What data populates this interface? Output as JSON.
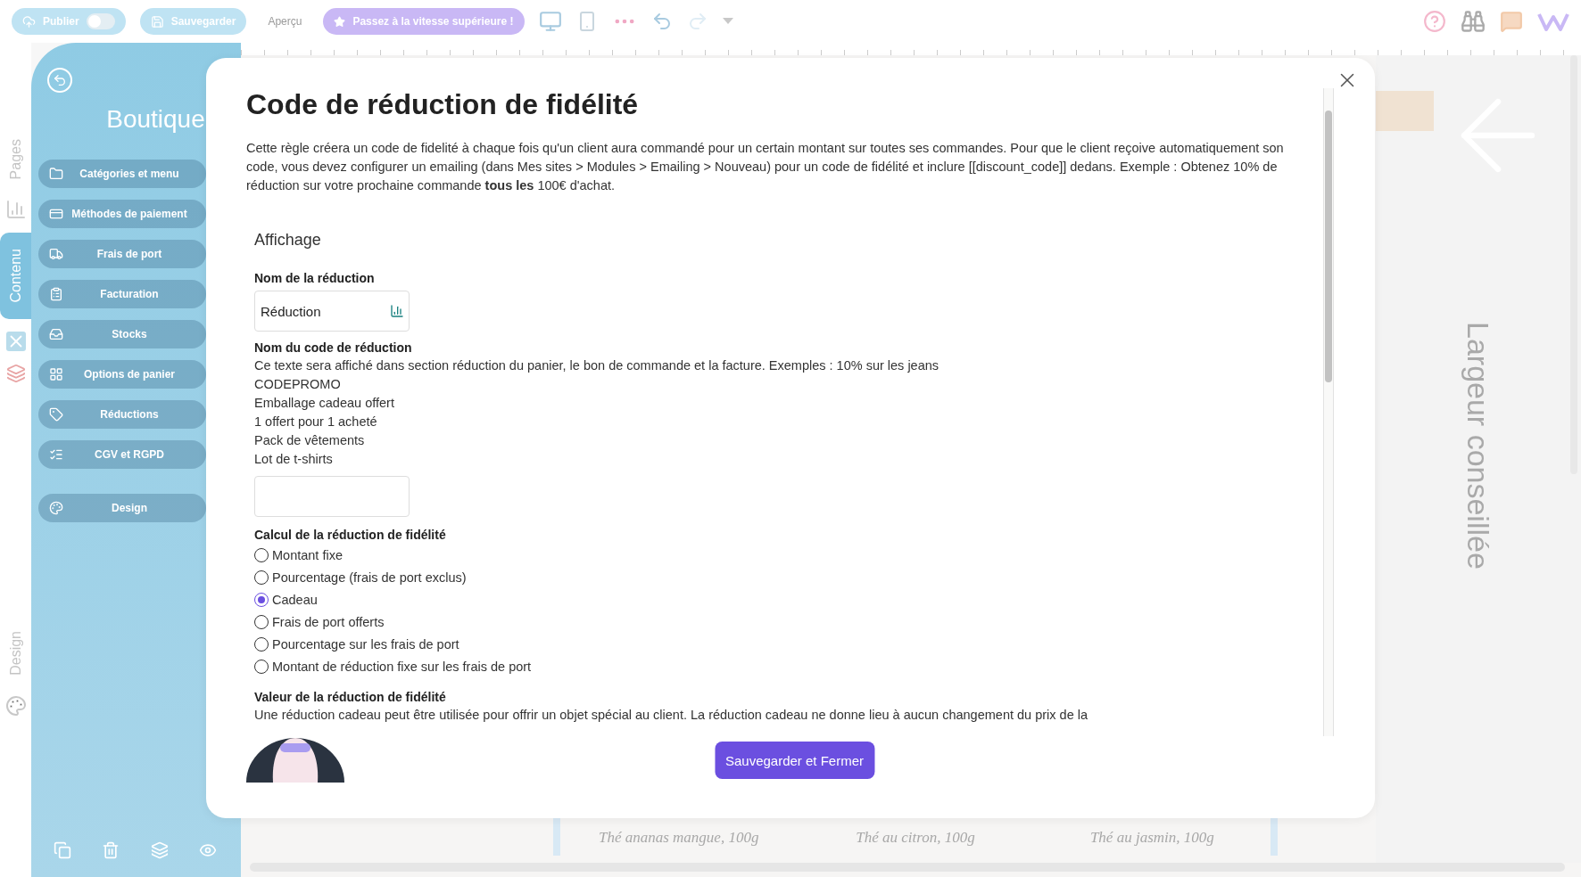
{
  "toolbar": {
    "publish": {
      "label": "Publier",
      "on": false
    },
    "save": "Sauvegarder",
    "preview": "Aperçu",
    "upgrade": "Passez à la vitesse supérieure !"
  },
  "side_tabs": [
    {
      "label": "Pages",
      "selected": false
    },
    {
      "label": "Contenu",
      "selected": true
    },
    {
      "label": "Design",
      "selected": false
    }
  ],
  "sidebar": {
    "title": "Boutique",
    "items": [
      {
        "label": "Catégories et menu"
      },
      {
        "label": "Méthodes de paiement"
      },
      {
        "label": "Frais de port"
      },
      {
        "label": "Facturation"
      },
      {
        "label": "Stocks"
      },
      {
        "label": "Options de panier"
      },
      {
        "label": "Réductions"
      },
      {
        "label": "CGV et RGPD"
      },
      {
        "label": "Design"
      }
    ]
  },
  "canvas": {
    "side_label": "Largeur conseillée",
    "products": [
      "Thé ananas mangue, 100g",
      "Thé au citron, 100g",
      "Thé au jasmin, 100g"
    ]
  },
  "modal": {
    "title": "Code de réduction de fidélité",
    "intro": "Cette règle créera un code de fidelité à chaque fois qu'un client aura commandé pour un certain montant sur toutes ses commandes. Pour que le client reçoive automatiquement son code, vous devez configurer un emailing (dans Mes sites > Modules > Emailing > Nouveau) pour un code de fidélité et inclure [[discount_code]] dedans. Exemple : Obtenez 10% de réduction sur votre prochaine commande **tous les** 100€ d'achat.",
    "section": "Affichage",
    "name_field": {
      "label": "Nom de la réduction",
      "value": "Réduction"
    },
    "code_field": {
      "label": "Nom du code de réduction",
      "help_lines": [
        "Ce texte sera affiché dans section réduction du panier, le bon de commande et la facture. Exemples : 10% sur les jeans",
        "CODEPROMO",
        "Emballage cadeau offert",
        "1 offert pour 1 acheté",
        "Pack de vêtements",
        "Lot de t-shirts"
      ]
    },
    "calc": {
      "label": "Calcul de la réduction de fidélité",
      "options": [
        {
          "label": "Montant fixe",
          "selected": false
        },
        {
          "label": "Pourcentage (frais de port exclus)",
          "selected": false
        },
        {
          "label": "Cadeau",
          "selected": true
        },
        {
          "label": "Frais de port offerts",
          "selected": false
        },
        {
          "label": "Pourcentage sur les frais de port",
          "selected": false
        },
        {
          "label": "Montant de réduction fixe sur les frais de port",
          "selected": false
        }
      ]
    },
    "value": {
      "label": "Valeur de la réduction de fidélité",
      "text": "Une réduction cadeau peut être utilisée pour offrir un objet spécial au client. La réduction cadeau ne donne lieu à aucun changement du prix de la"
    },
    "submit": "Sauvegarder et Fermer"
  }
}
